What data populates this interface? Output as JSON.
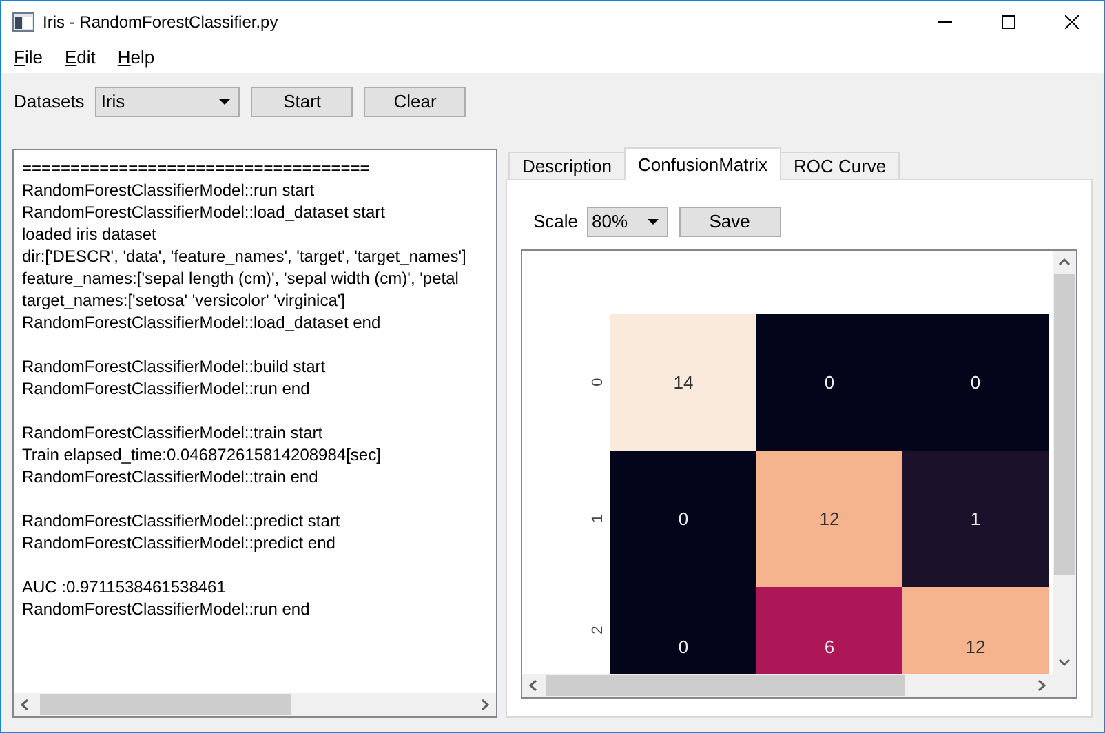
{
  "window": {
    "title": "Iris - RandomForestClassifier.py"
  },
  "menu": [
    {
      "label": "File",
      "underlined_initial": true
    },
    {
      "label": "Edit",
      "underlined_initial": true
    },
    {
      "label": "Help",
      "underlined_initial": true
    }
  ],
  "toolbar": {
    "datasets_label": "Datasets",
    "dataset": "Iris",
    "buttons": [
      "Start",
      "Clear"
    ]
  },
  "log": [
    [
      "====================================",
      "RandomForestClassifierModel::run start",
      "RandomForestClassifierModel::load_dataset start",
      "loaded iris dataset",
      "dir:['DESCR', 'data', 'feature_names', 'target', 'target_names']",
      "feature_names:['sepal length (cm)', 'sepal width (cm)', 'petal",
      "target_names:['setosa' 'versicolor' 'virginica']",
      "RandomForestClassifierModel::load_dataset end"
    ],
    [
      "RandomForestClassifierModel::build start",
      "RandomForestClassifierModel::run end"
    ],
    [
      "RandomForestClassifierModel::train start",
      "Train elapsed_time:0.046872615814208984[sec]",
      "RandomForestClassifierModel::train end"
    ],
    [
      "RandomForestClassifierModel::predict start",
      "RandomForestClassifierModel::predict end"
    ],
    [
      "AUC :0.9711538461538461",
      "RandomForestClassifierModel::run end"
    ]
  ],
  "tabs": [
    {
      "label": "Description",
      "selected": false
    },
    {
      "label": "ConfusionMatrix",
      "selected": true
    },
    {
      "label": "ROC Curve",
      "selected": false
    }
  ],
  "scale": {
    "label": "Scale",
    "value": "80%",
    "button": "Save"
  },
  "matrix": {
    "rows": [
      {
        "label": "0",
        "cells": [
          {
            "value": "14",
            "color": "#faeadc"
          },
          {
            "value": "0",
            "color": "#03051a"
          },
          {
            "value": "0",
            "color": "#03051a"
          }
        ]
      },
      {
        "label": "1",
        "cells": [
          {
            "value": "0",
            "color": "#03051a"
          },
          {
            "value": "12",
            "color": "#f5b48e"
          },
          {
            "value": "1",
            "color": "#1b112b"
          }
        ]
      },
      {
        "label": "2",
        "cells": [
          {
            "value": "0",
            "color": "#03051a"
          },
          {
            "value": "6",
            "color": "#ae1757"
          },
          {
            "value": "12",
            "color": "#f5b48e"
          }
        ]
      }
    ]
  }
}
